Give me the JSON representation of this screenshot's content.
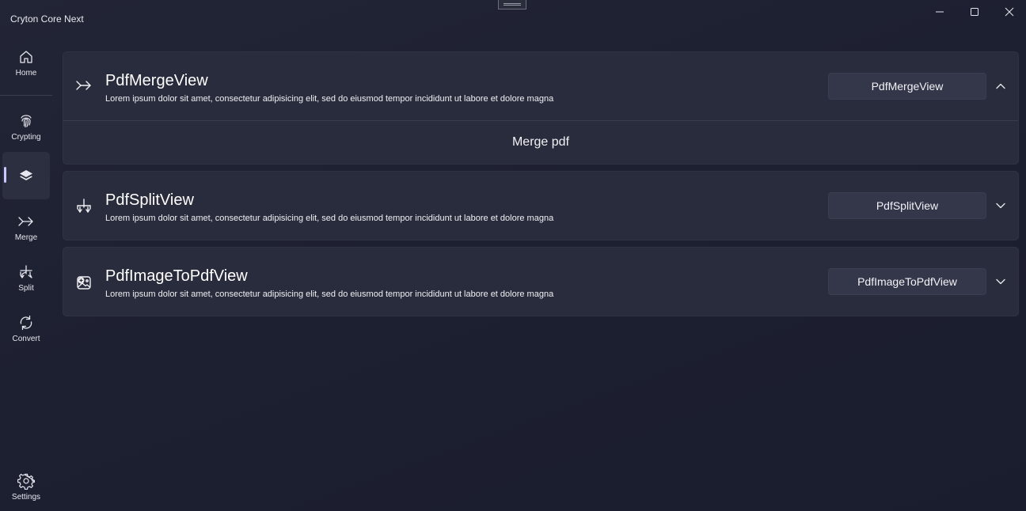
{
  "window": {
    "title": "Cryton Core Next",
    "controls": {
      "minimize": "minimize-icon",
      "maximize": "maximize-icon",
      "close": "close-icon"
    }
  },
  "nav": {
    "items": [
      {
        "label": "Home",
        "icon": "home-icon"
      },
      {
        "label": "Crypting",
        "icon": "fingerprint-icon"
      },
      {
        "label": "",
        "icon": "layers-icon",
        "active": true
      },
      {
        "label": "Merge",
        "icon": "merge-icon"
      },
      {
        "label": "Split",
        "icon": "split-icon"
      },
      {
        "label": "Convert",
        "icon": "convert-icon"
      }
    ],
    "footer": {
      "label": "Settings",
      "icon": "settings-icon"
    }
  },
  "cards": [
    {
      "title": "PdfMergeView",
      "description": "Lorem ipsum dolor sit amet, consectetur adipisicing elit, sed do eiusmod tempor incididunt ut labore et dolore magna",
      "button": "PdfMergeView",
      "expanded": true,
      "body": "Merge pdf",
      "icon": "merge-icon"
    },
    {
      "title": "PdfSplitView",
      "description": "Lorem ipsum dolor sit amet, consectetur adipisicing elit, sed do eiusmod tempor incididunt ut labore et dolore magna",
      "button": "PdfSplitView",
      "expanded": false,
      "icon": "split-icon"
    },
    {
      "title": "PdfImageToPdfView",
      "description": "Lorem ipsum dolor sit amet, consectetur adipisicing elit, sed do eiusmod tempor incididunt ut labore et dolore magna",
      "button": "PdfImageToPdfView",
      "expanded": false,
      "icon": "image-to-pdf-icon"
    }
  ],
  "colors": {
    "accent": "#c9c8ff",
    "card": "#292c3c",
    "background": "#1d2031"
  }
}
